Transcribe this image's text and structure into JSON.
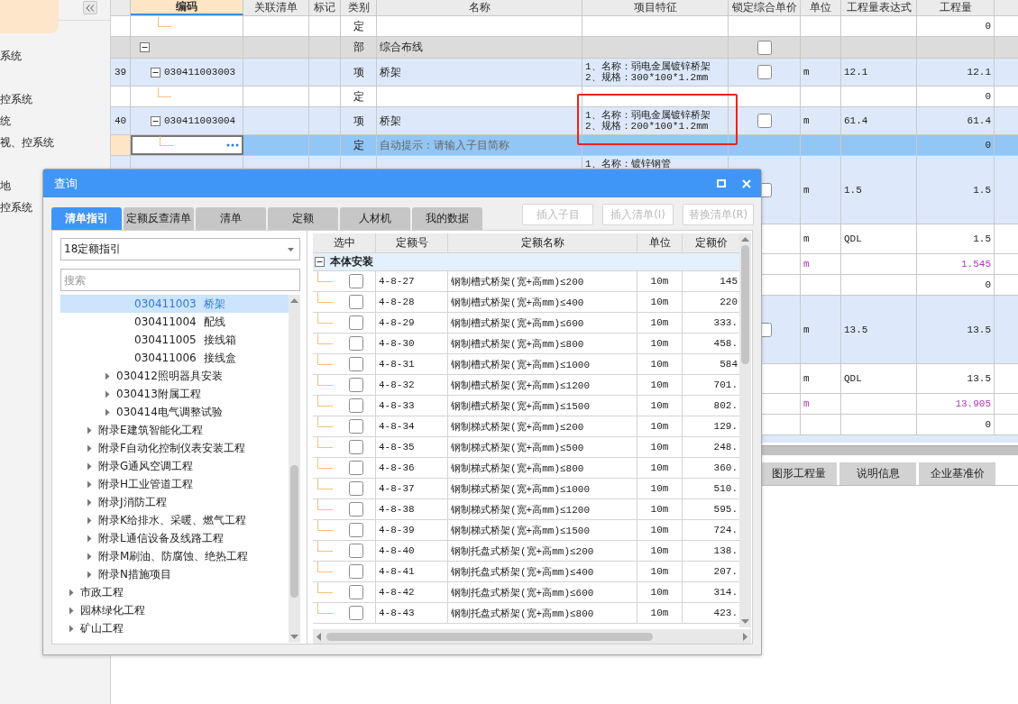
{
  "sidebar": {
    "groups": [
      {
        "items": [
          "系统"
        ]
      },
      {
        "items": [
          "控系统",
          "统",
          "视、控系统"
        ]
      },
      {
        "items": [
          "地",
          "控系统"
        ]
      }
    ]
  },
  "grid": {
    "columns": [
      {
        "label": "编码",
        "selected": true
      },
      {
        "label": "关联清单",
        "selected": false
      },
      {
        "label": "标记",
        "selected": false
      },
      {
        "label": "类别",
        "selected": false
      },
      {
        "label": "名称",
        "selected": false
      },
      {
        "label": "项目特征",
        "selected": false
      },
      {
        "label": "锁定综合单价",
        "selected": false
      },
      {
        "label": "单位",
        "selected": false
      },
      {
        "label": "工程量表达式",
        "selected": false
      },
      {
        "label": "工程量",
        "selected": false
      }
    ],
    "rows": [
      {
        "kind": "quota",
        "selected": false,
        "type": "定",
        "qty": "0"
      },
      {
        "kind": "section",
        "selected": false,
        "expanded": true,
        "type": "部",
        "name": "综合布线",
        "locked": false
      },
      {
        "kind": "item",
        "selected": false,
        "num": "39",
        "expanded": true,
        "code": "030411003003",
        "type": "项",
        "name": "桥架",
        "feature": [
          "1、名称：弱电金属镀锌桥架",
          "2、规格：300*100*1.2mm"
        ],
        "locked": false,
        "unit": "m",
        "expr": "12.1",
        "qty": "12.1"
      },
      {
        "kind": "quota",
        "selected": false,
        "type": "定",
        "qty": "0"
      },
      {
        "kind": "item",
        "selected": false,
        "num": "40",
        "expanded": true,
        "code": "030411003004",
        "type": "项",
        "name": "桥架",
        "feature": [
          "1、名称：弱电金属镀锌桥架",
          "2、规格：200*100*1.2mm"
        ],
        "highlighted": true,
        "locked": false,
        "unit": "m",
        "expr": "61.4",
        "qty": "61.4"
      },
      {
        "kind": "quota",
        "selected": true,
        "type": "定",
        "hint": "自动提示：请输入子目简称",
        "qty": "0"
      },
      {
        "kind": "item_long",
        "selected": false,
        "feature": [
          "1、名称：镀锌钢管"
        ],
        "locked": false,
        "unit": "m",
        "expr": "1.5",
        "qty": "1.5"
      },
      {
        "kind": "measure",
        "selected": false,
        "unit": "m",
        "expr": "QDL",
        "qty": "1.5"
      },
      {
        "kind": "material",
        "selected": false,
        "unit": "m",
        "qty": "1.545"
      },
      {
        "kind": "quota",
        "selected": false,
        "qty": "0"
      },
      {
        "kind": "item_long",
        "selected": false,
        "locked": false,
        "unit": "m",
        "expr": "13.5",
        "qty": "13.5"
      },
      {
        "kind": "measure",
        "selected": false,
        "unit": "m",
        "expr": "QDL",
        "qty": "13.5"
      },
      {
        "kind": "material",
        "selected": false,
        "unit": "m",
        "qty": "13.905"
      },
      {
        "kind": "quota",
        "selected": false,
        "qty": "0"
      }
    ]
  },
  "bottom_tabs": [
    "图形工程量",
    "说明信息",
    "企业基准价"
  ],
  "dialog": {
    "title": "查询",
    "tabs": [
      {
        "label": "清单指引",
        "selected": true
      },
      {
        "label": "定额反查清单",
        "selected": false
      },
      {
        "label": "清单",
        "selected": false
      },
      {
        "label": "定额",
        "selected": false
      },
      {
        "label": "人材机",
        "selected": false
      },
      {
        "label": "我的数据",
        "selected": false
      }
    ],
    "buttons": [
      {
        "label": "插入子目",
        "disabled": true
      },
      {
        "label": "插入清单(I)",
        "disabled": true
      },
      {
        "label": "替换清单(R)",
        "disabled": true
      }
    ],
    "guide_select": {
      "value": "18定额指引"
    },
    "search": {
      "placeholder": "搜索"
    },
    "tree": [
      {
        "children": [
          {
            "children": [
              {
                "children": [
                  {
                    "code": "030411003",
                    "name": "桥架",
                    "selected": true
                  },
                  {
                    "code": "030411004",
                    "name": "配线",
                    "selected": false
                  },
                  {
                    "code": "030411005",
                    "name": "接线箱",
                    "selected": false
                  },
                  {
                    "code": "030411006",
                    "name": "接线盒",
                    "selected": false
                  }
                ]
              },
              {
                "label": "030412照明器具安装",
                "expanded": false,
                "selected": false
              },
              {
                "label": "030413附属工程",
                "expanded": false,
                "selected": false
              },
              {
                "label": "030414电气调整试验",
                "expanded": false,
                "selected": false
              }
            ]
          },
          {
            "label": "附录E建筑智能化工程",
            "expanded": false,
            "selected": false
          },
          {
            "label": "附录F自动化控制仪表安装工程",
            "expanded": false,
            "selected": false
          },
          {
            "label": "附录G通风空调工程",
            "expanded": false,
            "selected": false
          },
          {
            "label": "附录H工业管道工程",
            "expanded": false,
            "selected": false
          },
          {
            "label": "附录J消防工程",
            "expanded": false,
            "selected": false
          },
          {
            "label": "附录K给排水、采暖、燃气工程",
            "expanded": false,
            "selected": false
          },
          {
            "label": "附录L通信设备及线路工程",
            "expanded": false,
            "selected": false
          },
          {
            "label": "附录M刷油、防腐蚀、绝热工程",
            "expanded": false,
            "selected": false
          },
          {
            "label": "附录N措施项目",
            "expanded": false,
            "selected": false
          }
        ]
      },
      {
        "label": "市政工程",
        "expanded": false,
        "selected": false
      },
      {
        "label": "园林绿化工程",
        "expanded": false,
        "selected": false
      },
      {
        "label": "矿山工程",
        "expanded": false,
        "selected": false
      }
    ],
    "table": {
      "columns": [
        "选中",
        "定额号",
        "定额名称",
        "单位",
        "定额价"
      ],
      "group": {
        "label": "本体安装",
        "expanded": true
      },
      "rows": [
        {
          "checked": false,
          "code": "4-8-27",
          "name": "钢制槽式桥架(宽+高mm)≤200",
          "unit": "10m",
          "price": "145"
        },
        {
          "checked": false,
          "code": "4-8-28",
          "name": "钢制槽式桥架(宽+高mm)≤400",
          "unit": "10m",
          "price": "220"
        },
        {
          "checked": false,
          "code": "4-8-29",
          "name": "钢制槽式桥架(宽+高mm)≤600",
          "unit": "10m",
          "price": "333."
        },
        {
          "checked": false,
          "code": "4-8-30",
          "name": "钢制槽式桥架(宽+高mm)≤800",
          "unit": "10m",
          "price": "458."
        },
        {
          "checked": false,
          "code": "4-8-31",
          "name": "钢制槽式桥架(宽+高mm)≤1000",
          "unit": "10m",
          "price": "584"
        },
        {
          "checked": false,
          "code": "4-8-32",
          "name": "钢制槽式桥架(宽+高mm)≤1200",
          "unit": "10m",
          "price": "701."
        },
        {
          "checked": false,
          "code": "4-8-33",
          "name": "钢制槽式桥架(宽+高mm)≤1500",
          "unit": "10m",
          "price": "802."
        },
        {
          "checked": false,
          "code": "4-8-34",
          "name": "钢制梯式桥架(宽+高mm)≤200",
          "unit": "10m",
          "price": "129."
        },
        {
          "checked": false,
          "code": "4-8-35",
          "name": "钢制梯式桥架(宽+高mm)≤500",
          "unit": "10m",
          "price": "248."
        },
        {
          "checked": false,
          "code": "4-8-36",
          "name": "钢制梯式桥架(宽+高mm)≤800",
          "unit": "10m",
          "price": "360."
        },
        {
          "checked": false,
          "code": "4-8-37",
          "name": "钢制梯式桥架(宽+高mm)≤1000",
          "unit": "10m",
          "price": "510."
        },
        {
          "checked": false,
          "code": "4-8-38",
          "name": "钢制梯式桥架(宽+高mm)≤1200",
          "unit": "10m",
          "price": "595."
        },
        {
          "checked": false,
          "code": "4-8-39",
          "name": "钢制梯式桥架(宽+高mm)≤1500",
          "unit": "10m",
          "price": "724."
        },
        {
          "checked": false,
          "code": "4-8-40",
          "name": "钢制托盘式桥架(宽+高mm)≤200",
          "unit": "10m",
          "price": "138."
        },
        {
          "checked": false,
          "code": "4-8-41",
          "name": "钢制托盘式桥架(宽+高mm)≤400",
          "unit": "10m",
          "price": "207."
        },
        {
          "checked": false,
          "code": "4-8-42",
          "name": "钢制托盘式桥架(宽+高mm)≤600",
          "unit": "10m",
          "price": "314."
        },
        {
          "checked": false,
          "code": "4-8-43",
          "name": "钢制托盘式桥架(宽+高mm)≤800",
          "unit": "10m",
          "price": "423."
        }
      ]
    }
  }
}
